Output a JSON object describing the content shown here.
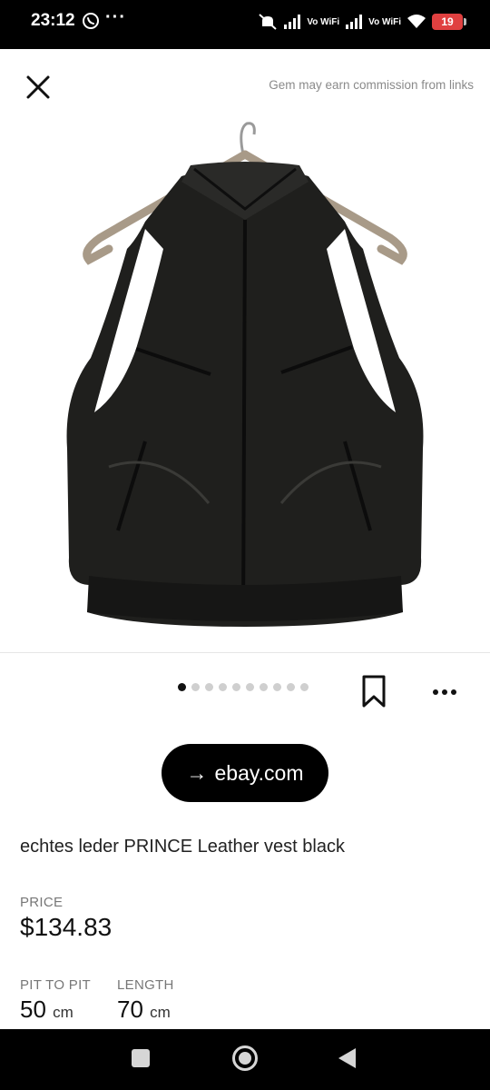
{
  "status_bar": {
    "time": "23:12",
    "overflow": "···",
    "vo_wifi_1": "Vo WiFi",
    "vo_wifi_2": "Vo WiFi",
    "battery": "19",
    "icons": [
      "viber-icon",
      "mute-icon",
      "signal-icon",
      "wifi-icon",
      "battery-icon"
    ]
  },
  "header": {
    "close_icon": "close-icon",
    "disclaimer": "Gem may earn commission from links"
  },
  "gallery": {
    "image_alt": "black leather vest",
    "pages": 10,
    "active_page": 1
  },
  "actions": {
    "bookmark_icon": "bookmark-icon",
    "more_icon": "more-icon"
  },
  "link_button": {
    "arrow": "→",
    "label": "ebay.com"
  },
  "listing": {
    "title": "echtes leder PRINCE Leather vest black",
    "price_label": "PRICE",
    "price": "$134.83",
    "measurements": [
      {
        "label": "PIT TO PIT",
        "value": "50",
        "unit": "cm"
      },
      {
        "label": "LENGTH",
        "value": "70",
        "unit": "cm"
      }
    ]
  },
  "colors": {
    "status_bar_bg": "#000000",
    "button_bg": "#000000",
    "battery": "#e04040",
    "muted_text": "#8a8a8a"
  }
}
